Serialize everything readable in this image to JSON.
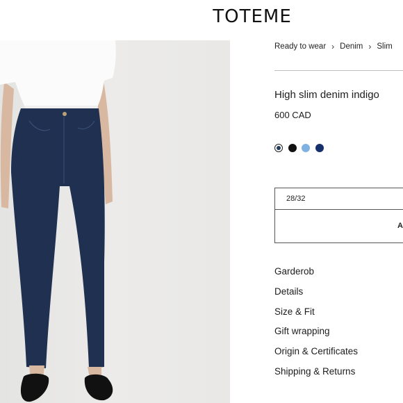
{
  "brand": {
    "logo": "TOTEME"
  },
  "breadcrumb": {
    "items": [
      "Ready to wear",
      "Denim",
      "Slim"
    ],
    "separator": "›"
  },
  "product": {
    "title": "High slim denim indigo",
    "price": "600 CAD",
    "image_alt": "Model wearing high slim denim jeans in indigo with white t-shirt and black loafers"
  },
  "colors": {
    "selected_index": 0,
    "swatches": [
      {
        "name": "indigo",
        "hex": "#223a5a"
      },
      {
        "name": "black",
        "hex": "#111111"
      },
      {
        "name": "light blue",
        "hex": "#7fb2e0"
      },
      {
        "name": "navy",
        "hex": "#16306b"
      }
    ]
  },
  "size_selector": {
    "value": "28/32"
  },
  "add_button": {
    "label": "A"
  },
  "accordion": {
    "items": [
      "Garderob",
      "Details",
      "Size & Fit",
      "Gift wrapping",
      "Origin & Certificates",
      "Shipping & Returns"
    ]
  }
}
